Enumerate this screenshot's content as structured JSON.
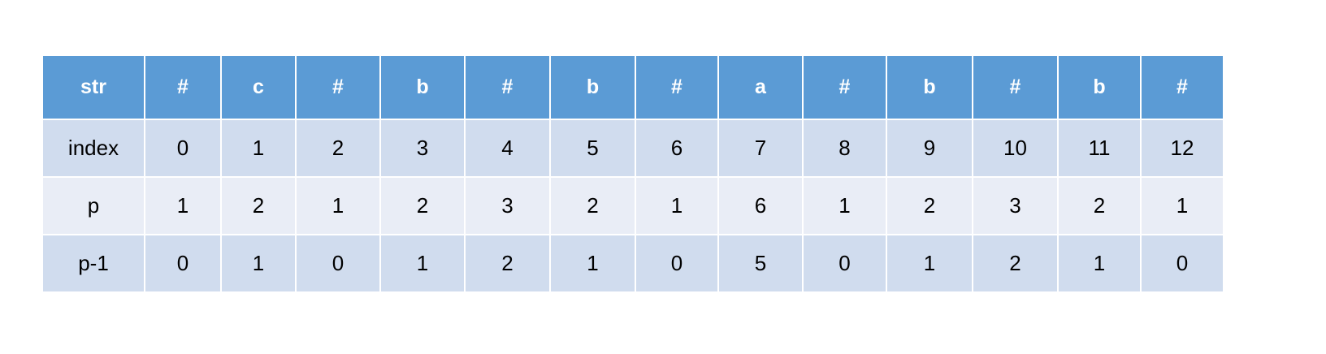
{
  "table": {
    "header": [
      "str",
      "#",
      "c",
      "#",
      "b",
      "#",
      "b",
      "#",
      "a",
      "#",
      "b",
      "#",
      "b",
      "#"
    ],
    "rows": [
      [
        "index",
        "0",
        "1",
        "2",
        "3",
        "4",
        "5",
        "6",
        "7",
        "8",
        "9",
        "10",
        "11",
        "12"
      ],
      [
        "p",
        "1",
        "2",
        "1",
        "2",
        "3",
        "2",
        "1",
        "6",
        "1",
        "2",
        "3",
        "2",
        "1"
      ],
      [
        "p-1",
        "0",
        "1",
        "0",
        "1",
        "2",
        "1",
        "0",
        "5",
        "0",
        "1",
        "2",
        "1",
        "0"
      ]
    ]
  },
  "colors": {
    "header": "#5b9bd5",
    "row_dark": "#d0dcee",
    "row_light": "#e9edf6"
  }
}
